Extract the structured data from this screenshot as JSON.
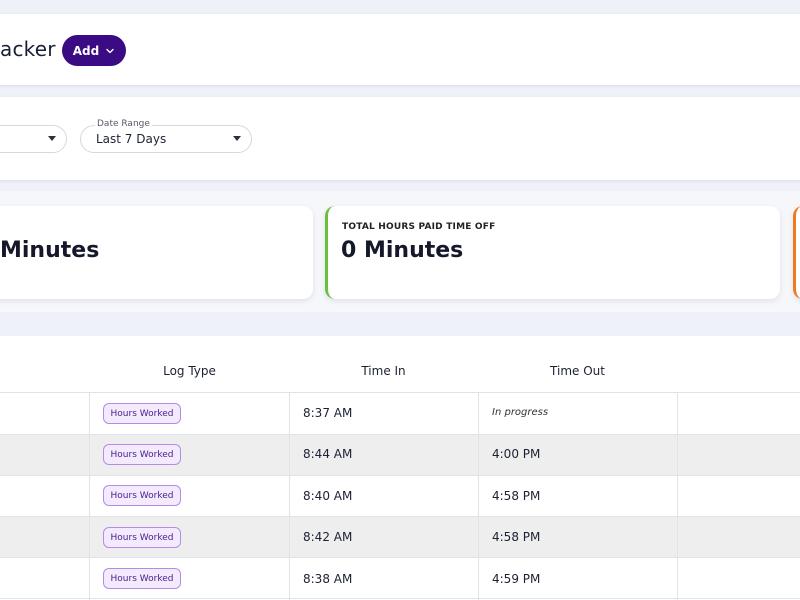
{
  "header": {
    "title": "acker",
    "add_label": "Add"
  },
  "filters": {
    "date_range_label": "Date Range",
    "date_range_value": "Last 7 Days"
  },
  "stats": [
    {
      "label": "",
      "value": "Minutes"
    },
    {
      "label": "TOTAL HOURS PAID TIME OFF",
      "value": "0 Minutes",
      "accent": "#6bbf3f"
    },
    {
      "accent": "#ee7a22"
    }
  ],
  "table": {
    "columns": [
      "Log Type",
      "Time In",
      "Time Out"
    ],
    "rows": [
      {
        "log_type": "Hours Worked",
        "time_in": "8:37 AM",
        "time_out": "In progress"
      },
      {
        "log_type": "Hours Worked",
        "time_in": "8:44 AM",
        "time_out": "4:00 PM"
      },
      {
        "log_type": "Hours Worked",
        "time_in": "8:40 AM",
        "time_out": "4:58 PM"
      },
      {
        "log_type": "Hours Worked",
        "time_in": "8:42 AM",
        "time_out": "4:58 PM"
      },
      {
        "log_type": "Hours Worked",
        "time_in": "8:38 AM",
        "time_out": "4:59 PM"
      }
    ]
  },
  "colors": {
    "brand": "#3b0b84",
    "badge_border": "#b48ce6",
    "badge_bg": "#f3eafd"
  },
  "icons": {
    "add_button": "chevron-down-icon",
    "select": "caret-down-icon"
  }
}
